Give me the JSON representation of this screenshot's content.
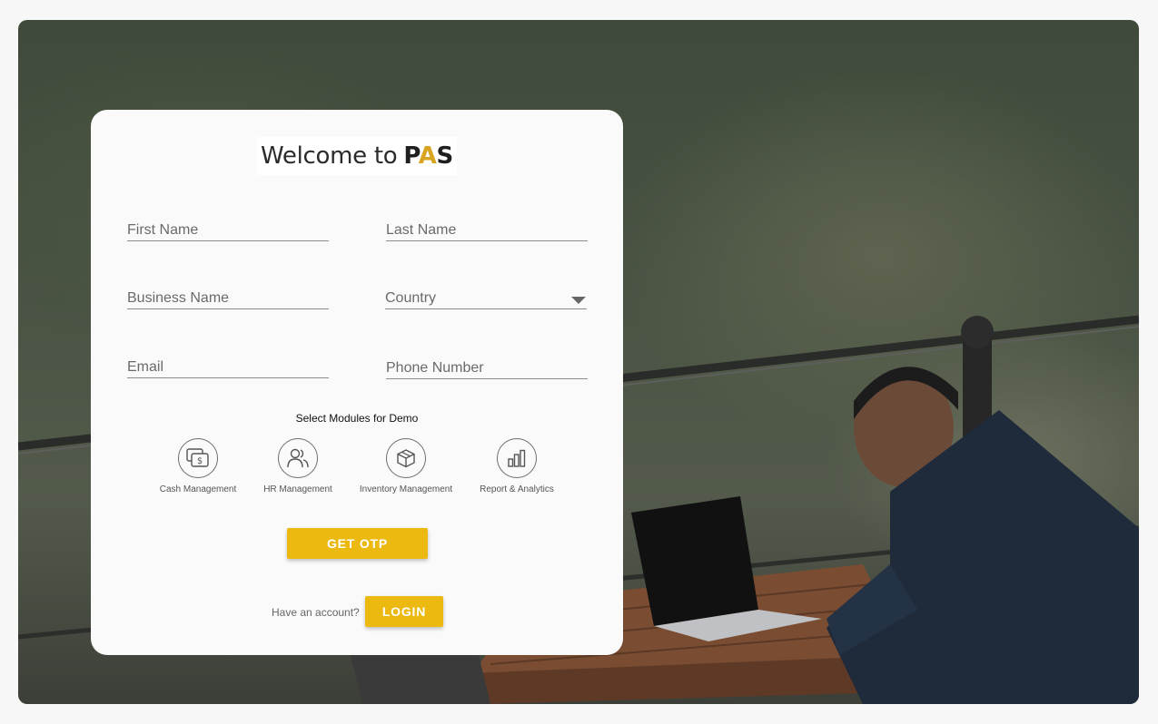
{
  "logo": {
    "prefix": "Welcome to",
    "brand_p": "P",
    "brand_a": "A",
    "brand_s": "S"
  },
  "form": {
    "first_name": {
      "placeholder": "First Name",
      "value": ""
    },
    "last_name": {
      "placeholder": "Last Name",
      "value": ""
    },
    "business_name": {
      "placeholder": "Business Name",
      "value": ""
    },
    "country": {
      "placeholder": "Country",
      "value": ""
    },
    "email": {
      "placeholder": "Email",
      "value": ""
    },
    "phone": {
      "placeholder": "Phone Number",
      "value": ""
    }
  },
  "modules": {
    "title": "Select Modules for Demo",
    "items": [
      {
        "label": "Cash Management",
        "icon": "cash-icon"
      },
      {
        "label": "HR Management",
        "icon": "users-icon"
      },
      {
        "label": "Inventory Management",
        "icon": "box-icon"
      },
      {
        "label": "Report & Analytics",
        "icon": "bar-chart-icon"
      }
    ]
  },
  "actions": {
    "get_otp": "GET OTP",
    "have_account": "Have an account?",
    "login": "LOGIN"
  },
  "colors": {
    "accent": "#ecb911",
    "brand_a": "#d9a521"
  }
}
